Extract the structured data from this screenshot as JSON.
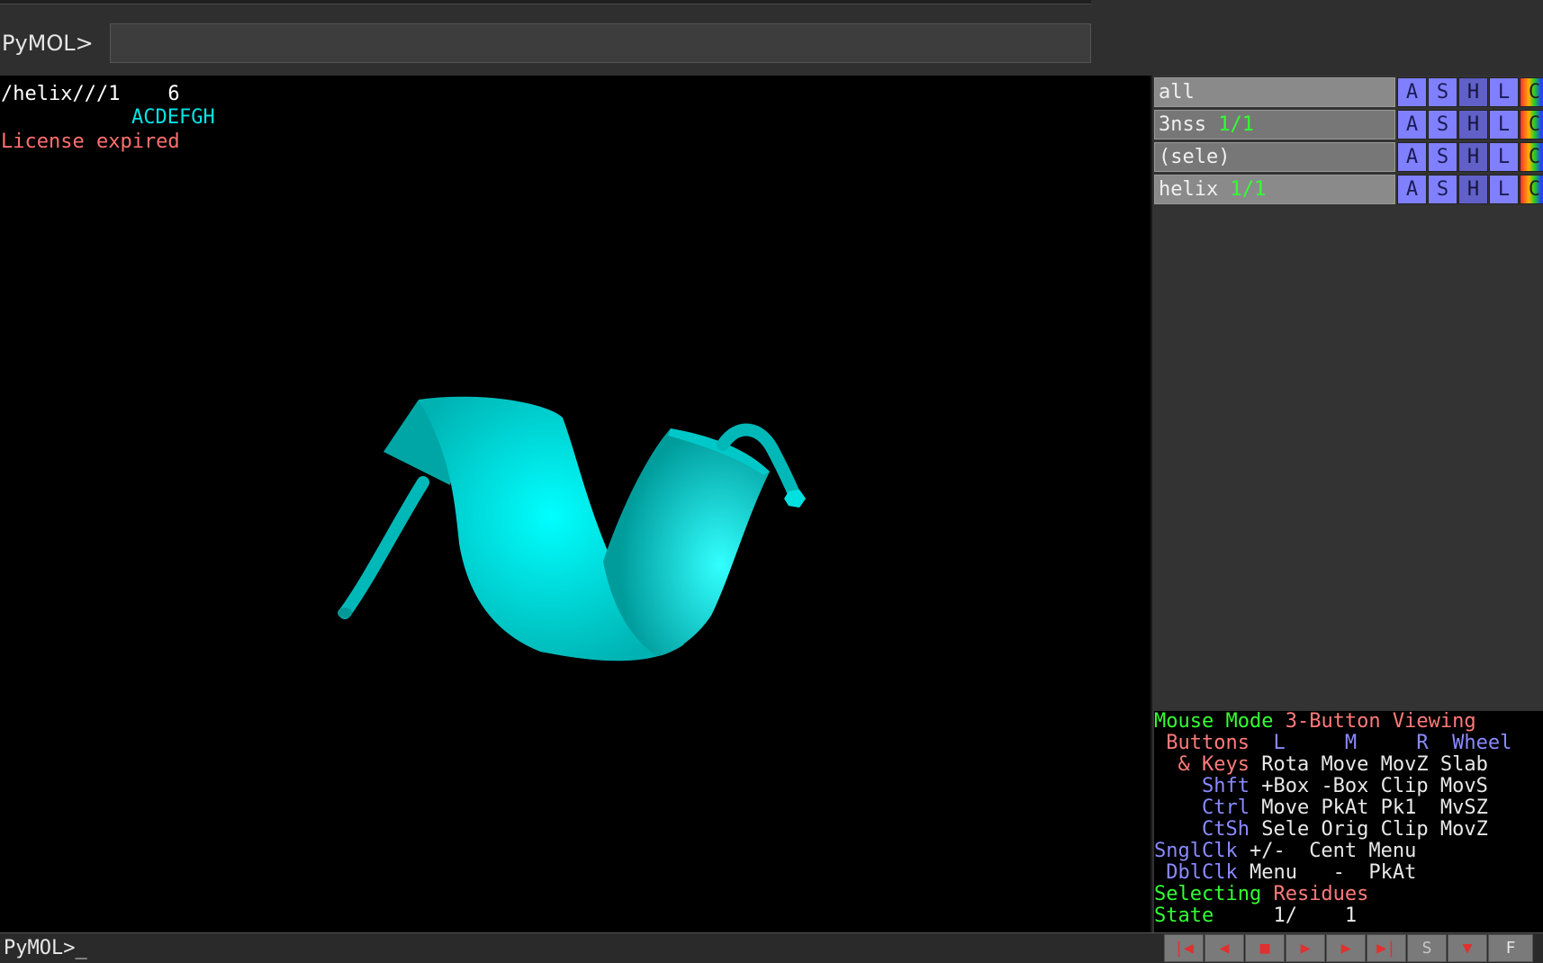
{
  "command": {
    "label": "PyMOL>",
    "value": "",
    "placeholder": ""
  },
  "viewer": {
    "sequence_path": "/helix///1    6",
    "sequence_letters": "ACDEFGH",
    "license_text": "License expired",
    "helix_color": "#00e5e5"
  },
  "objects": [
    {
      "name": "all",
      "state": ""
    },
    {
      "name": "3nss ",
      "state": "1/1"
    },
    {
      "name": "(sele)",
      "state": ""
    },
    {
      "name": "helix ",
      "state": "1/1"
    }
  ],
  "object_buttons": {
    "a": "A",
    "s": "S",
    "h": "H",
    "l": "L",
    "c": "C"
  },
  "mouse_mode": {
    "line1a": "Mouse Mode ",
    "line1b": "3-Button Viewing",
    "line2a": " Buttons",
    "line2b": "  L     M     R  Wheel",
    "line3a": "  & Keys",
    "line3b": " Rota Move MovZ Slab",
    "line4a": "    Shft",
    "line4b": " +Box -Box Clip MovS",
    "line5a": "    Ctrl",
    "line5b": " Move PkAt Pk1  MvSZ",
    "line6a": "    CtSh",
    "line6b": " Sele Orig Clip MovZ",
    "line7a": "SnglClk",
    "line7b": " +/-  Cent Menu",
    "line8a": " DblClk",
    "line8b": " Menu   -  PkAt",
    "line9a": "Selecting ",
    "line9b": "Residues",
    "line10a": "State",
    "line10b": "     1/    1"
  },
  "prompt": "PyMOL>_",
  "movie_controls": [
    "|◀",
    "◀",
    "■",
    "▶",
    "▶",
    "▶|",
    "S",
    "▼",
    "F"
  ]
}
